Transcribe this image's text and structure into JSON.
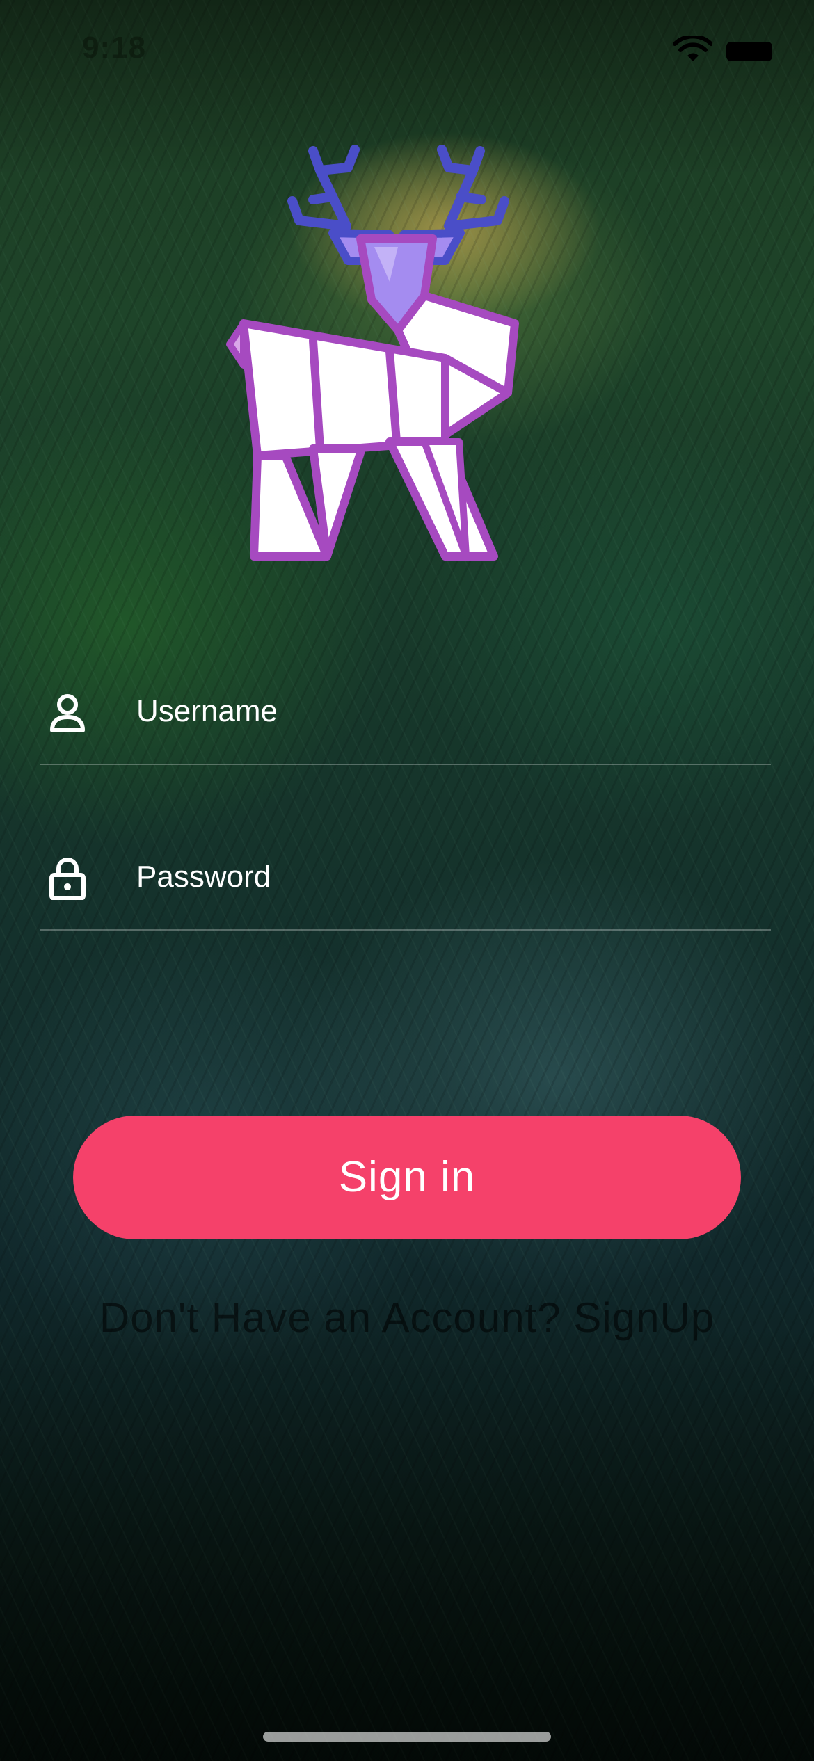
{
  "status_bar": {
    "time": "9:18",
    "wifi_icon": "wifi-icon",
    "battery_icon": "battery-icon"
  },
  "logo": {
    "icon": "deer-logo-icon",
    "colors": {
      "antlers": "#4a4ec8",
      "head": "#a48cf0",
      "body": "#ffffff",
      "outline": "#a64ac0"
    }
  },
  "form": {
    "username": {
      "icon": "person-icon",
      "placeholder": "Username"
    },
    "password": {
      "icon": "lock-icon",
      "placeholder": "Password"
    }
  },
  "signin_button": {
    "label": "Sign in",
    "color": "#f5416a"
  },
  "signup_link": {
    "text": "Don't Have an Account? SignUp"
  }
}
